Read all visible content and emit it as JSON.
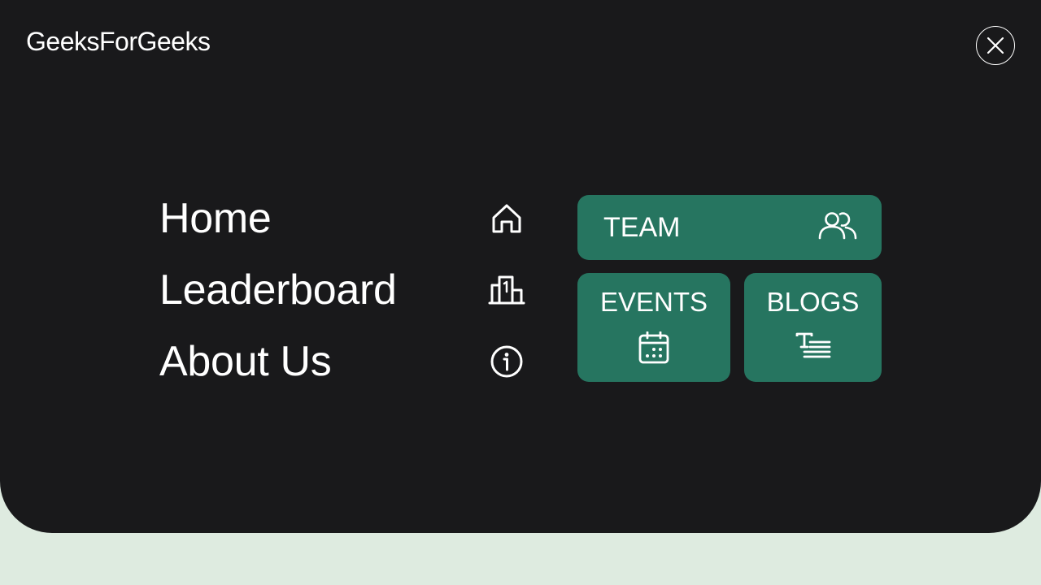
{
  "header": {
    "brand": "GeeksForGeeks",
    "close_icon": "close-icon"
  },
  "nav": {
    "items": [
      {
        "label": "Home",
        "icon": "home-icon"
      },
      {
        "label": "Leaderboard",
        "icon": "podium-icon"
      },
      {
        "label": "About Us",
        "icon": "info-icon"
      }
    ]
  },
  "tiles": {
    "team": {
      "label": "TEAM",
      "icon": "users-icon"
    },
    "events": {
      "label": "EVENTS",
      "icon": "calendar-icon"
    },
    "blogs": {
      "label": "BLOGS",
      "icon": "text-lines-icon"
    }
  },
  "colors": {
    "panel_background": "#19191b",
    "page_background": "#deebe0",
    "tile_background": "#267560",
    "text": "#ffffff"
  }
}
